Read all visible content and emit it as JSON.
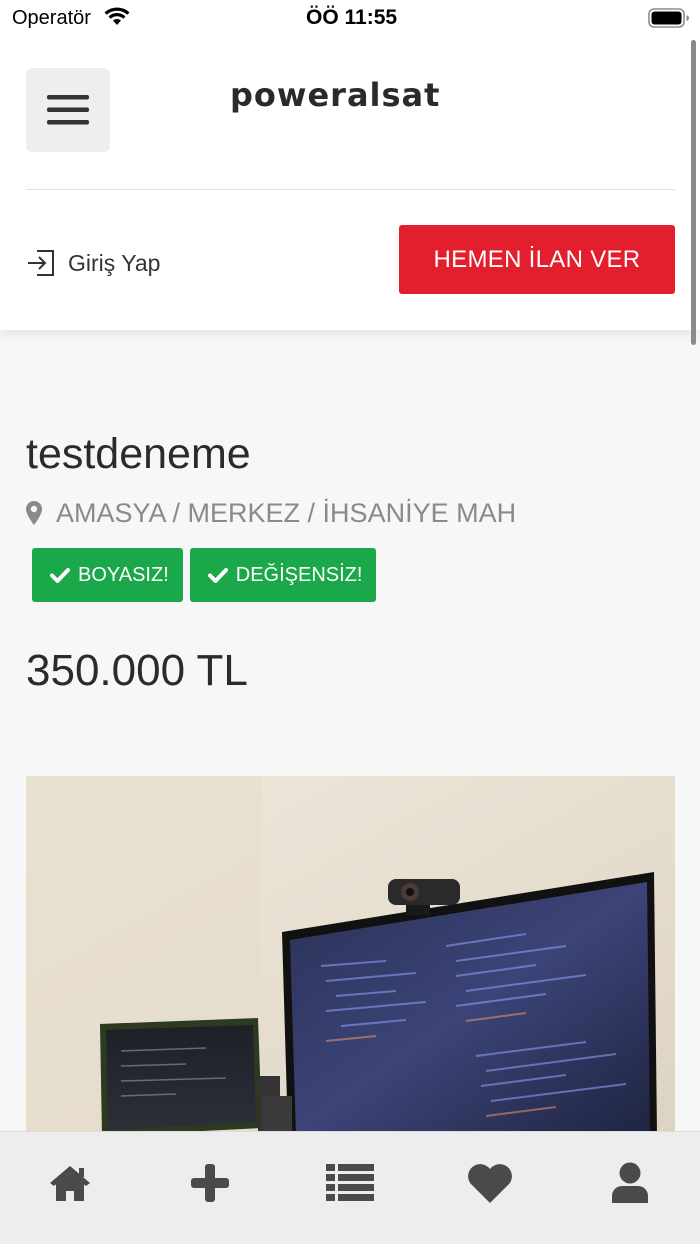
{
  "status_bar": {
    "carrier": "Operatör",
    "time": "ÖÖ 11:55",
    "icons": [
      "wifi-icon",
      "battery-icon"
    ]
  },
  "header": {
    "logo": "poweralsat",
    "menu_icon": "hamburger-icon",
    "login_label": "Giriş Yap",
    "login_icon": "sign-in-icon",
    "cta_label": "HEMEN İLAN VER",
    "cta_color": "#e31e2d"
  },
  "listing": {
    "title": "testdeneme",
    "location": "AMASYA / MERKEZ / İHSANİYE MAH",
    "location_icon": "map-marker-icon",
    "badges": [
      "BOYASIZ!",
      "DEĞİŞENSİZ!"
    ],
    "badge_color": "#1aa84a",
    "price": "350.000 TL",
    "photo": "desk-setup-photo"
  },
  "tabbar": {
    "items": [
      "home-icon",
      "plus-icon",
      "list-icon",
      "heart-icon",
      "user-icon"
    ]
  }
}
